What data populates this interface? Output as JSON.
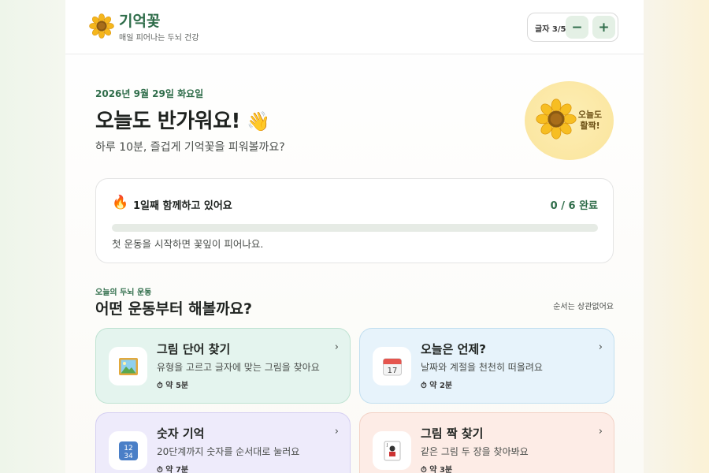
{
  "header": {
    "brand_name": "기억꽃",
    "brand_sub": "매일 피어나는 두뇌 건강",
    "font_size_label": "글자 3/5",
    "font_size_level": 3,
    "font_size_max": 5,
    "minus_label": "−",
    "plus_label": "+"
  },
  "hero": {
    "date": "2026년 9월 29일 화요일",
    "greeting": "오늘도 반가워요!",
    "greeting_emoji": "👋",
    "subline": "하루 10분, 즐겁게 기억꽃을 피워볼까요?",
    "badge_text": "오늘도 활짝!"
  },
  "progress": {
    "streak_icon": "fire-icon",
    "streak_label": "1일째 함께하고 있어요",
    "done_label": "0 / 6 완료",
    "completed": 0,
    "total": 6,
    "hint": "첫 운동을 시작하면 꽃잎이 피어나요."
  },
  "section": {
    "eyebrow": "오늘의 두뇌 운동",
    "title": "어떤 운동부터 해볼까요?",
    "note": "순서는 상관없어요"
  },
  "exercises": [
    {
      "title": "그림 단어 찾기",
      "desc": "유형을 고르고 글자에 맞는 그림을 찾아요",
      "time": "⏱ 약 5분",
      "icon": "picture-frame-icon",
      "glyph": "🖼️"
    },
    {
      "title": "오늘은 언제?",
      "desc": "날짜와 계절을 천천히 떠올려요",
      "time": "⏱ 약 2분",
      "icon": "calendar-icon",
      "glyph": "📅"
    },
    {
      "title": "숫자 기억",
      "desc": "20단계까지 숫자를 순서대로 눌러요",
      "time": "⏱ 약 7분",
      "icon": "number-keys-icon",
      "glyph": "🔢"
    },
    {
      "title": "그림 짝 찾기",
      "desc": "같은 그림 두 장을 찾아봐요",
      "time": "⏱ 약 3분",
      "icon": "playing-card-icon",
      "glyph": "🃏"
    }
  ],
  "colors": {
    "accent": "#2f6d4a",
    "progress_track": "#e6ebe5",
    "badge_bg": "#fbe7a3"
  }
}
